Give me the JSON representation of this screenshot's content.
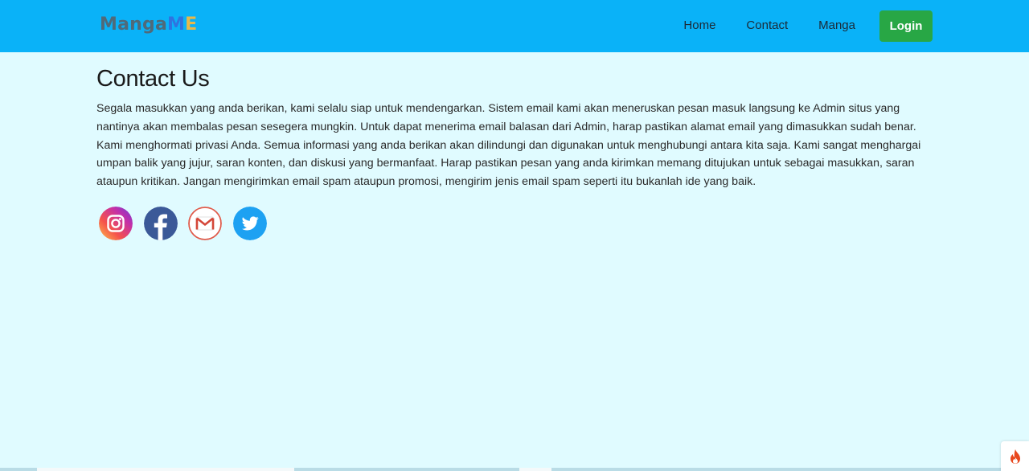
{
  "navbar": {
    "brand": {
      "part1": "Manga",
      "part2": "M",
      "part3": "E"
    },
    "links": [
      "Home",
      "Contact",
      "Manga"
    ],
    "login_label": "Login",
    "colors": {
      "background": "#0ab2f8",
      "login": "#28a745"
    }
  },
  "main": {
    "title": "Contact Us",
    "paragraph": "Segala masukkan yang anda berikan, kami selalu siap untuk mendengarkan. Sistem email kami akan meneruskan pesan masuk langsung ke Admin situs yang nantinya akan membalas pesan sesegera mungkin. Untuk dapat menerima email balasan dari Admin, harap pastikan alamat email yang dimasukkan sudah benar. Kami menghormati privasi Anda. Semua informasi yang anda berikan akan dilindungi dan digunakan untuk menghubungi antara kita saja. Kami sangat menghargai umpan balik yang jujur, saran konten, dan diskusi yang bermanfaat. Harap pastikan pesan yang anda kirimkan memang ditujukan untuk sebagai masukkan, saran ataupun kritikan. Jangan mengirimkan email spam ataupun promosi, mengirim jenis email spam seperti itu bukanlah ide yang baik."
  },
  "socials": [
    "instagram-icon",
    "facebook-icon",
    "gmail-icon",
    "twitter-icon"
  ],
  "page_background": "#e0fbff"
}
